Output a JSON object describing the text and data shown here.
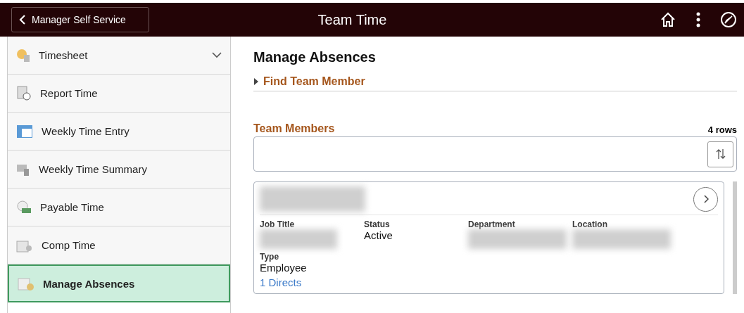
{
  "header": {
    "back_label": "Manager Self Service",
    "title": "Team Time"
  },
  "sidebar": {
    "items": [
      {
        "label": "Timesheet",
        "selected": false,
        "has_submenu": true
      },
      {
        "label": "Report Time",
        "selected": false,
        "has_submenu": false
      },
      {
        "label": "Weekly Time Entry",
        "selected": false,
        "has_submenu": false
      },
      {
        "label": "Weekly Time Summary",
        "selected": false,
        "has_submenu": false
      },
      {
        "label": "Payable Time",
        "selected": false,
        "has_submenu": false
      },
      {
        "label": "Comp Time",
        "selected": false,
        "has_submenu": false
      },
      {
        "label": "Manage Absences",
        "selected": true,
        "has_submenu": false
      }
    ]
  },
  "page_title": "Manage Absences",
  "find_section": {
    "label": "Find Team Member",
    "expanded": false
  },
  "team_members": {
    "title": "Team Members",
    "row_count": "4 rows",
    "cards": [
      {
        "fields": [
          {
            "label": "Job Title"
          },
          {
            "label": "Status",
            "value": "Active"
          },
          {
            "label": "Department"
          },
          {
            "label": "Location"
          },
          {
            "label": "Type",
            "value": "Employee"
          }
        ],
        "link": "1 Directs"
      }
    ]
  }
}
